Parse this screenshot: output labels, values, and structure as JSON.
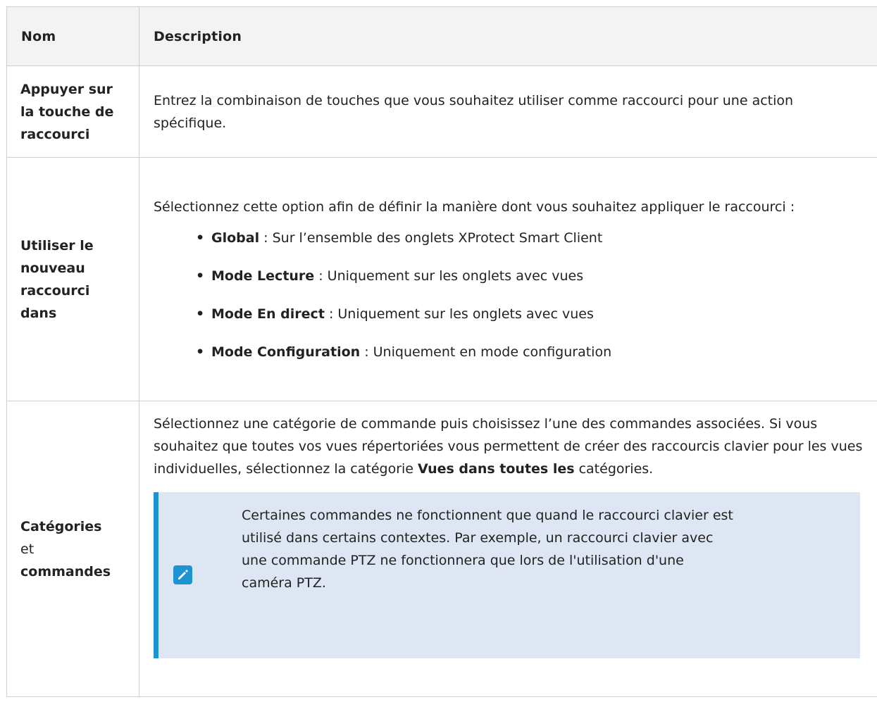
{
  "table": {
    "headers": {
      "name": "Nom",
      "description": "Description"
    },
    "rows": [
      {
        "name": "Appuyer sur la touche de raccourci",
        "description": "Entrez la combinaison de touches que vous souhaitez utiliser comme raccourci pour une action spécifique."
      },
      {
        "name": "Utiliser le nouveau raccourci dans",
        "intro": "Sélectionnez cette option afin de définir la manière dont vous souhaitez appliquer le raccourci :",
        "options": [
          {
            "label": "Global",
            "text": " : Sur l’ensemble des onglets XProtect Smart Client"
          },
          {
            "label": "Mode Lecture",
            "text": " : Uniquement sur les onglets avec vues"
          },
          {
            "label": "Mode En direct",
            "text": " : Uniquement sur les onglets avec vues"
          },
          {
            "label": "Mode Configuration",
            "text": " : Uniquement en mode configuration"
          }
        ]
      },
      {
        "name_bold_1": "Catégories",
        "name_plain": "et",
        "name_bold_2": "commandes",
        "description_start": "Sélectionnez une catégorie de commande puis choisissez l’une des commandes associées. Si vous souhaitez que toutes vos vues répertoriées vous permettent de créer des raccourcis clavier pour les vues individuelles, sélectionnez la catégorie ",
        "description_bold": "Vues dans toutes les",
        "description_end": " catégories.",
        "note": {
          "icon": "pencil-icon",
          "text": "Certaines commandes ne fonctionnent que quand le raccourci clavier est utilisé dans certains contextes. Par exemple, un raccourci clavier avec une commande PTZ ne fonctionnera que lors de l'utilisation d'une caméra PTZ."
        }
      }
    ]
  },
  "colors": {
    "header_bg": "#f3f3f3",
    "border": "#cfcfcf",
    "note_bg": "#dde6f2",
    "note_accent": "#1e93d1"
  }
}
